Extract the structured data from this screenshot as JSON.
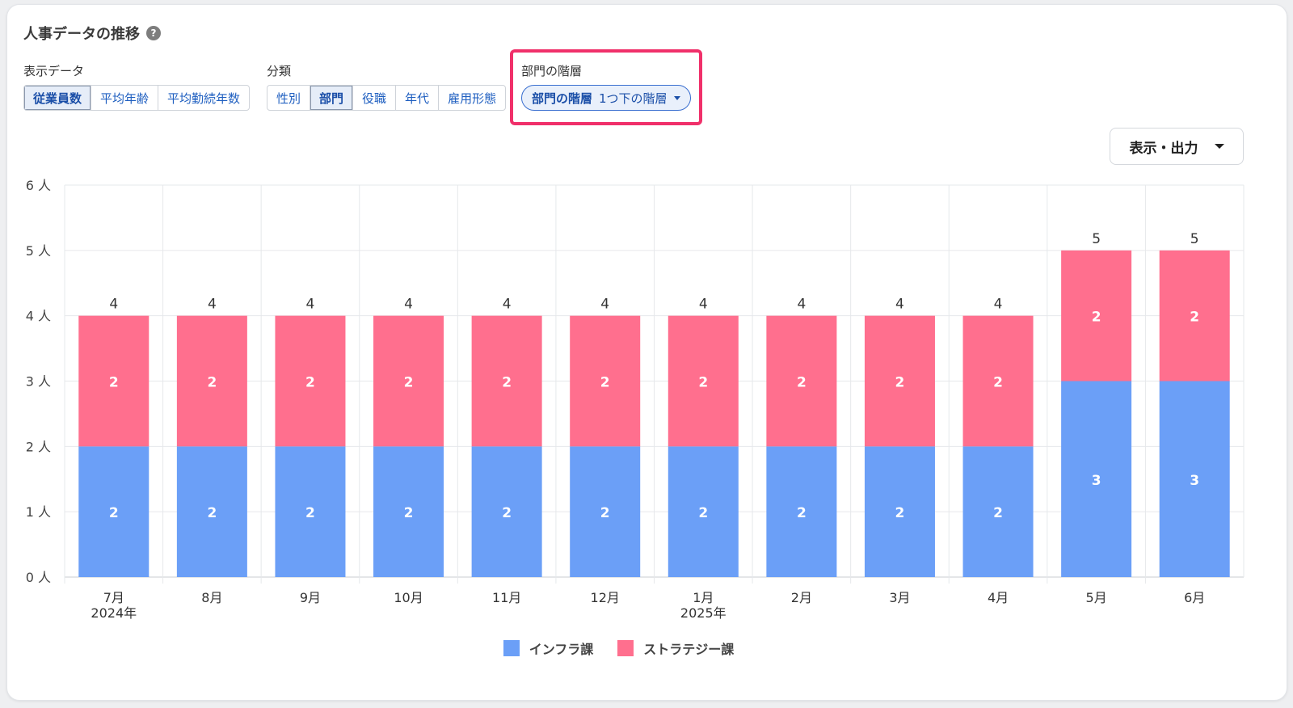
{
  "title": "人事データの推移",
  "help_icon": "question-circle-icon",
  "display_data": {
    "label": "表示データ",
    "options": [
      "従業員数",
      "平均年齢",
      "平均勤続年数"
    ],
    "selected": "従業員数"
  },
  "classification": {
    "label": "分類",
    "options": [
      "性別",
      "部門",
      "役職",
      "年代",
      "雇用形態"
    ],
    "selected": "部門"
  },
  "hierarchy": {
    "label": "部門の階層",
    "pill_label": "部門の階層",
    "pill_value": "1つ下の階層"
  },
  "export_button": "表示・出力",
  "colors": {
    "infra": "#6b9ff7",
    "strategy": "#ff6f8e",
    "highlight": "#f0306a"
  },
  "chart_data": {
    "type": "bar",
    "stacked": true,
    "categories": [
      "7月",
      "8月",
      "9月",
      "10月",
      "11月",
      "12月",
      "1月",
      "2月",
      "3月",
      "4月",
      "5月",
      "6月"
    ],
    "year_labels": [
      "2024年",
      "",
      "",
      "",
      "",
      "",
      "2025年",
      "",
      "",
      "",
      "",
      ""
    ],
    "series": [
      {
        "name": "インフラ課",
        "values": [
          2,
          2,
          2,
          2,
          2,
          2,
          2,
          2,
          2,
          2,
          3,
          3
        ]
      },
      {
        "name": "ストラテジー課",
        "values": [
          2,
          2,
          2,
          2,
          2,
          2,
          2,
          2,
          2,
          2,
          2,
          2
        ]
      }
    ],
    "totals": [
      4,
      4,
      4,
      4,
      4,
      4,
      4,
      4,
      4,
      4,
      5,
      5
    ],
    "y_ticks": [
      "0 人",
      "1 人",
      "2 人",
      "3 人",
      "4 人",
      "5 人",
      "6 人"
    ],
    "ylim": [
      0,
      6
    ],
    "grid": true,
    "legend_position": "bottom"
  }
}
